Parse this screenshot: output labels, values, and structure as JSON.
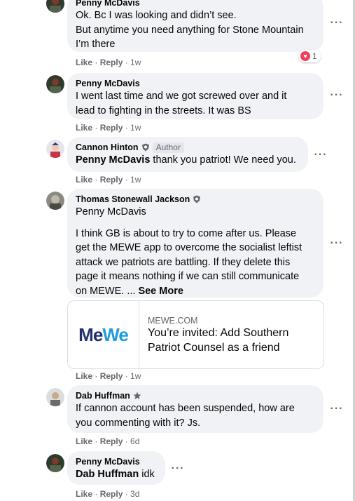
{
  "actions": {
    "like": "Like",
    "reply": "Reply",
    "more_icon": "more-dots-icon"
  },
  "comments": [
    {
      "author": "Penny McDavis",
      "lines": [
        "Ok. Bc I was looking and didn’t see.",
        "But anytime you need anything for Stone Mountain",
        "I’m there"
      ],
      "time": "1w",
      "reaction": {
        "type": "love",
        "count": "1",
        "color": "#f33e58"
      }
    },
    {
      "author": "Penny McDavis",
      "lines": [
        "I went last time and we got screwed over and it",
        "lead to fighting in the streets. It was BS"
      ],
      "time": "1w"
    },
    {
      "author": "Cannon Hinton",
      "author_tag": "Author",
      "mention": "Penny McDavis",
      "text": " thank you patriot! We need you.",
      "time": "1w"
    },
    {
      "author": "Thomas Stonewall Jackson",
      "mention_line": "Penny McDavis",
      "lines": [
        "I think GB is about to try to come after us. Please",
        "get the MEWE app to overcome the socialist leftist",
        "attack we patriots are battling. If they delete this",
        "page it means nothing if we can still communicate"
      ],
      "last_line": "on MEWE. ... ",
      "see_more": "See More",
      "time": "1w",
      "link": {
        "logo_me": "Me",
        "logo_we": "We",
        "domain": "MEWE.COM",
        "title_lines": [
          "You’re invited: Add Southern",
          "Patriot Counsel as a friend"
        ]
      }
    },
    {
      "author": "Dab Huffman",
      "lines": [
        "If cannon account has been suspended, how are",
        "you commenting with it? Js."
      ],
      "time": "6d"
    },
    {
      "author": "Penny McDavis",
      "mention": "Dab Huffman",
      "text": " idk",
      "time": "3d"
    }
  ]
}
